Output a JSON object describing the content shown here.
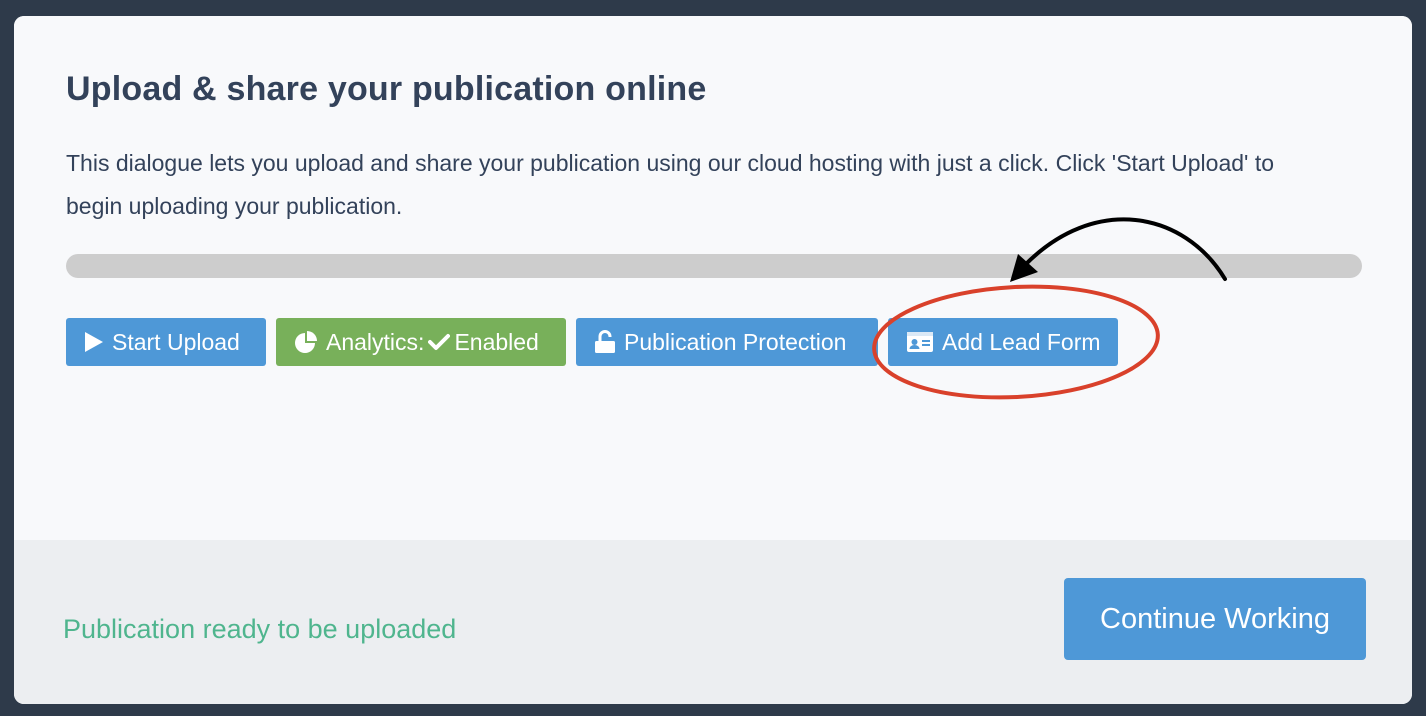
{
  "dialog": {
    "title": "Upload & share your publication online",
    "description": "This dialogue lets you upload and share your publication using our cloud hosting with just a click. Click 'Start Upload' to begin uploading your publication."
  },
  "progress": {
    "value": 0
  },
  "actions": {
    "start_upload": {
      "label": "Start Upload",
      "icon": "play-icon"
    },
    "analytics": {
      "label_prefix": "Analytics:",
      "label_status": "Enabled",
      "icon": "pie-chart-icon",
      "status_icon": "check-icon"
    },
    "publication_protection": {
      "label": "Publication Protection",
      "icon": "unlock-icon"
    },
    "add_lead_form": {
      "label": "Add Lead Form",
      "icon": "id-card-icon"
    }
  },
  "footer": {
    "status_text": "Publication ready to be uploaded",
    "continue_label": "Continue Working"
  },
  "colors": {
    "primary_button": "#4e98d7",
    "enabled_button": "#78b05a",
    "status_text": "#4fb58e",
    "title_text": "#33425a",
    "annotation_circle": "#d9412b",
    "annotation_arrow": "#000000"
  }
}
